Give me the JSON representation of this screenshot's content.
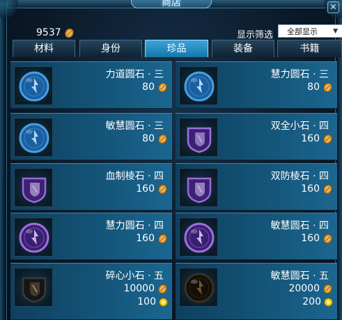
{
  "window": {
    "title": "商店"
  },
  "header": {
    "currency_value": "9537",
    "filter_label": "显示筛选",
    "filter_value": "全部显示"
  },
  "tabs": [
    {
      "label": "材料",
      "active": false
    },
    {
      "label": "身份",
      "active": false
    },
    {
      "label": "珍品",
      "active": true
    },
    {
      "label": "装备",
      "active": false
    },
    {
      "label": "书籍",
      "active": false
    }
  ],
  "items": [
    {
      "name": "力道圆石 · 三",
      "price": "80",
      "icon": "blue-round-gem-icon"
    },
    {
      "name": "慧力圆石 · 三",
      "price": "80",
      "icon": "blue-round-gem-icon"
    },
    {
      "name": "敏慧圆石 · 三",
      "price": "80",
      "icon": "blue-round-gem-icon"
    },
    {
      "name": "双全小石 · 四",
      "price": "160",
      "icon": "purple-small-stone-icon"
    },
    {
      "name": "血制棱石 · 四",
      "price": "160",
      "icon": "purple-prism-stone-icon"
    },
    {
      "name": "双防棱石 · 四",
      "price": "160",
      "icon": "purple-prism-stone-icon"
    },
    {
      "name": "慧力圆石 · 四",
      "price": "160",
      "icon": "purple-round-gem-icon"
    },
    {
      "name": "敏慧圆石 · 四",
      "price": "160",
      "icon": "purple-round-gem-icon"
    },
    {
      "name": "碎心小石 · 五",
      "price": "10000",
      "gold": "100",
      "icon": "dark-small-stone-icon"
    },
    {
      "name": "敏慧圆石 · 五",
      "price": "20000",
      "gold": "200",
      "icon": "dark-round-gem-icon"
    }
  ],
  "colors": {
    "active_tab": "#2a8cc4",
    "item_bg": "#145478",
    "coin": "#e0a040",
    "gold": "#f5d020"
  }
}
